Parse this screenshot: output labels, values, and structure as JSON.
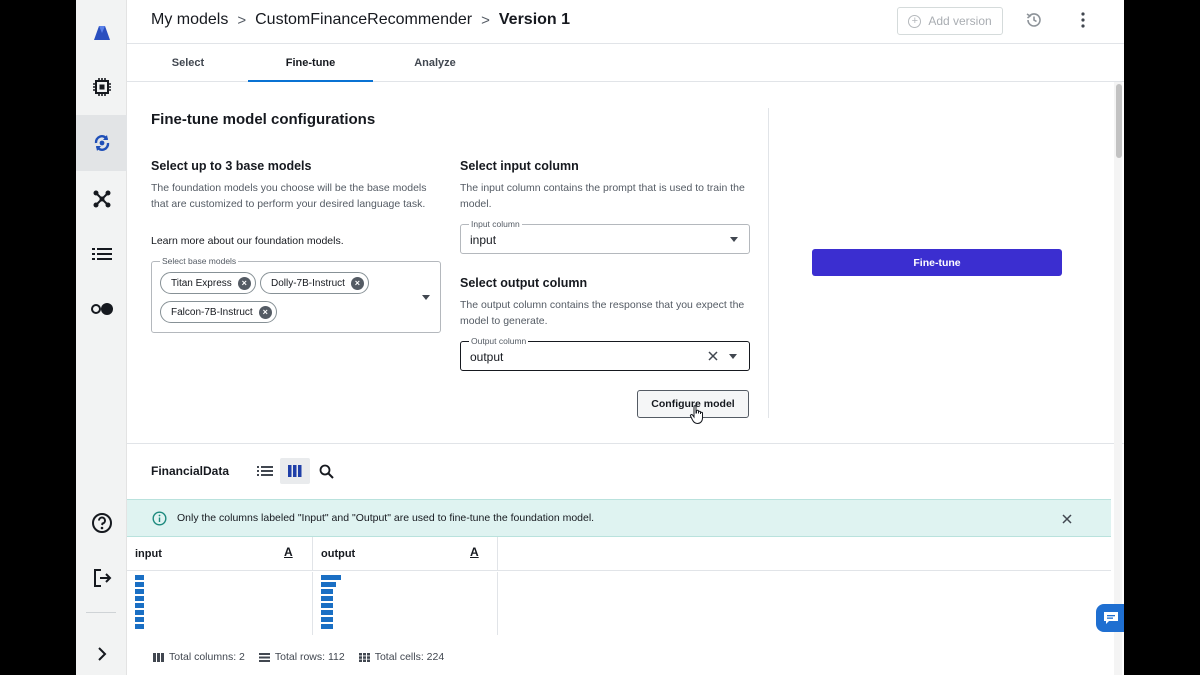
{
  "header": {
    "crumb_1": "My models",
    "crumb_2": "CustomFinanceRecommender",
    "crumb_3": "Version 1",
    "add_version": "Add version"
  },
  "tabs": [
    {
      "label": "Select"
    },
    {
      "label": "Fine-tune"
    },
    {
      "label": "Analyze"
    }
  ],
  "config": {
    "title": "Fine-tune model configurations",
    "base_models": {
      "heading": "Select up to 3 base models",
      "description": "The foundation models you choose will be the base models that are customized to perform your desired language task.",
      "link": "Learn more about our foundation models.",
      "field_label": "Select base models",
      "chips": [
        "Titan Express",
        "Dolly-7B-Instruct",
        "Falcon-7B-Instruct"
      ]
    },
    "input_column": {
      "heading": "Select input column",
      "description": "The input column contains the prompt that is used to train the model.",
      "field_label": "Input column",
      "value": "input"
    },
    "output_column": {
      "heading": "Select output column",
      "description": "The output column contains the response that you expect the model to generate.",
      "field_label": "Output column",
      "value": "output"
    },
    "configure_button": "Configure model",
    "finetune_button": "Fine-tune"
  },
  "dataset": {
    "name": "FinancialData",
    "banner": "Only the columns labeled \"Input\" and \"Output\" are used to fine-tune the foundation model.",
    "columns": [
      {
        "name": "input",
        "type": "A"
      },
      {
        "name": "output",
        "type": "A"
      }
    ],
    "footer": {
      "columns": "Total columns: 2",
      "rows": "Total rows: 112",
      "cells": "Total cells: 224"
    }
  },
  "colors": {
    "primary_button": "#3b2ed0",
    "tab_underline": "#0972d3",
    "banner_bg": "#dff3f1",
    "histogram_bar": "#1a6fc4"
  }
}
